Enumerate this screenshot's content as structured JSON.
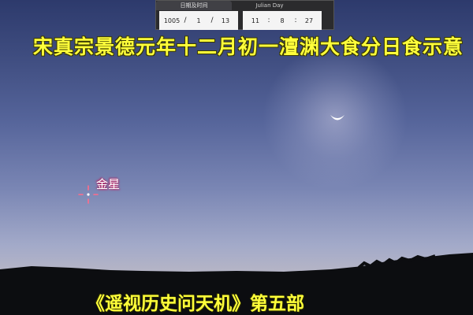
{
  "datetime": {
    "tab_date_time": "日期及时间",
    "tab_julian_day": "Julian Day",
    "year": "1005",
    "month": "1",
    "day": "13",
    "hour": "11",
    "minute": "8",
    "second": "27",
    "date_separator": "/",
    "time_separator": ":"
  },
  "overlay": {
    "title": "宋真宗景德元年十二月初一澶渊大食分日食示意",
    "venus_label": "金星",
    "footer": "《遥视历史问天机》第五部"
  },
  "colors": {
    "title_text": "#ffff3a",
    "label_glow": "#c2185b",
    "marker": "#ff6b8a"
  },
  "icons": {
    "moon": "crescent-sun-icon",
    "venus": "target-marker-icon"
  }
}
